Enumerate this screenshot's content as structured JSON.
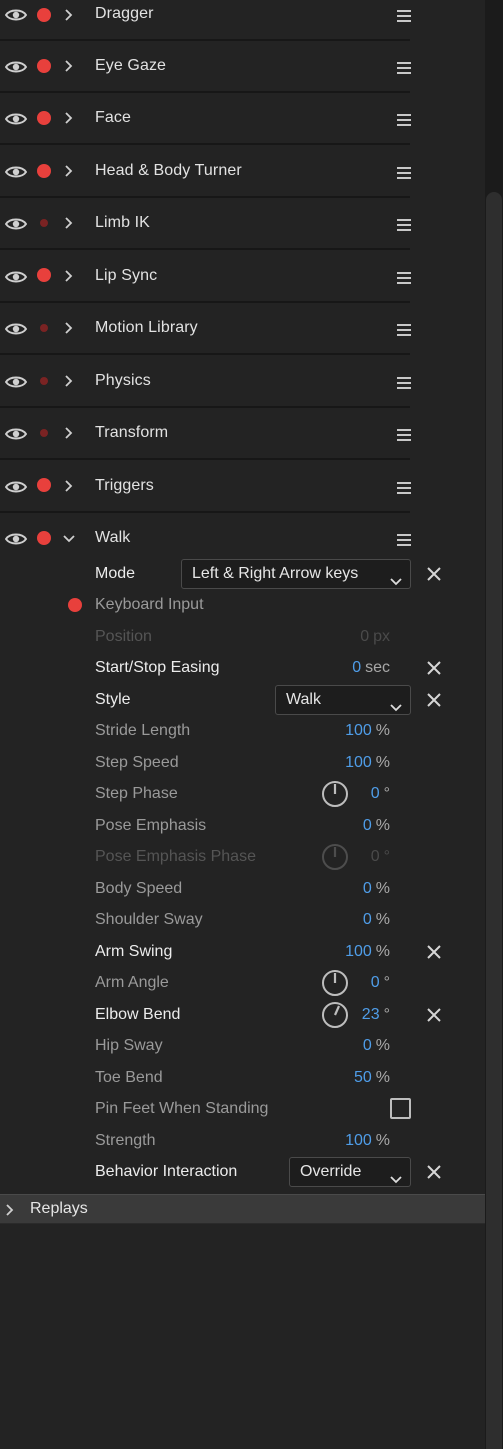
{
  "behaviors": [
    {
      "name": "Dragger",
      "armed": true,
      "expanded": false
    },
    {
      "name": "Eye Gaze",
      "armed": true,
      "expanded": false
    },
    {
      "name": "Face",
      "armed": true,
      "expanded": false
    },
    {
      "name": "Head & Body Turner",
      "armed": true,
      "expanded": false
    },
    {
      "name": "Limb IK",
      "armed": false,
      "expanded": false
    },
    {
      "name": "Lip Sync",
      "armed": true,
      "expanded": false
    },
    {
      "name": "Motion Library",
      "armed": false,
      "expanded": false
    },
    {
      "name": "Physics",
      "armed": false,
      "expanded": false
    },
    {
      "name": "Transform",
      "armed": false,
      "expanded": false
    },
    {
      "name": "Triggers",
      "armed": true,
      "expanded": false
    },
    {
      "name": "Walk",
      "armed": true,
      "expanded": true
    }
  ],
  "walk": {
    "mode": {
      "label": "Mode",
      "value": "Left & Right Arrow keys"
    },
    "keyboard_input": {
      "label": "Keyboard Input"
    },
    "position": {
      "label": "Position",
      "value": "0",
      "unit": "px"
    },
    "start_stop_easing": {
      "label": "Start/Stop Easing",
      "value": "0",
      "unit": "sec"
    },
    "style": {
      "label": "Style",
      "value": "Walk"
    },
    "stride_length": {
      "label": "Stride Length",
      "value": "100",
      "unit": "%"
    },
    "step_speed": {
      "label": "Step Speed",
      "value": "100",
      "unit": "%"
    },
    "step_phase": {
      "label": "Step Phase",
      "value": "0",
      "unit": "°"
    },
    "pose_emphasis": {
      "label": "Pose Emphasis",
      "value": "0",
      "unit": "%"
    },
    "pose_emphasis_phase": {
      "label": "Pose Emphasis Phase",
      "value": "0",
      "unit": "°"
    },
    "body_speed": {
      "label": "Body Speed",
      "value": "0",
      "unit": "%"
    },
    "shoulder_sway": {
      "label": "Shoulder Sway",
      "value": "0",
      "unit": "%"
    },
    "arm_swing": {
      "label": "Arm Swing",
      "value": "100",
      "unit": "%"
    },
    "arm_angle": {
      "label": "Arm Angle",
      "value": "0",
      "unit": "°"
    },
    "elbow_bend": {
      "label": "Elbow Bend",
      "value": "23",
      "unit": "°"
    },
    "hip_sway": {
      "label": "Hip Sway",
      "value": "0",
      "unit": "%"
    },
    "toe_bend": {
      "label": "Toe Bend",
      "value": "50",
      "unit": "%"
    },
    "pin_feet": {
      "label": "Pin Feet When Standing",
      "checked": false
    },
    "strength": {
      "label": "Strength",
      "value": "100",
      "unit": "%"
    },
    "behavior_interaction": {
      "label": "Behavior Interaction",
      "value": "Override"
    }
  },
  "replays": {
    "label": "Replays"
  },
  "colors": {
    "armed_red": "#e8403c",
    "value_blue": "#4f9de8",
    "background": "#232323"
  },
  "icons": [
    "eye-icon",
    "record-dot-icon",
    "chevron-right-icon",
    "chevron-down-icon",
    "hamburger-menu-icon",
    "close-icon",
    "dial-icon",
    "checkbox-icon"
  ]
}
